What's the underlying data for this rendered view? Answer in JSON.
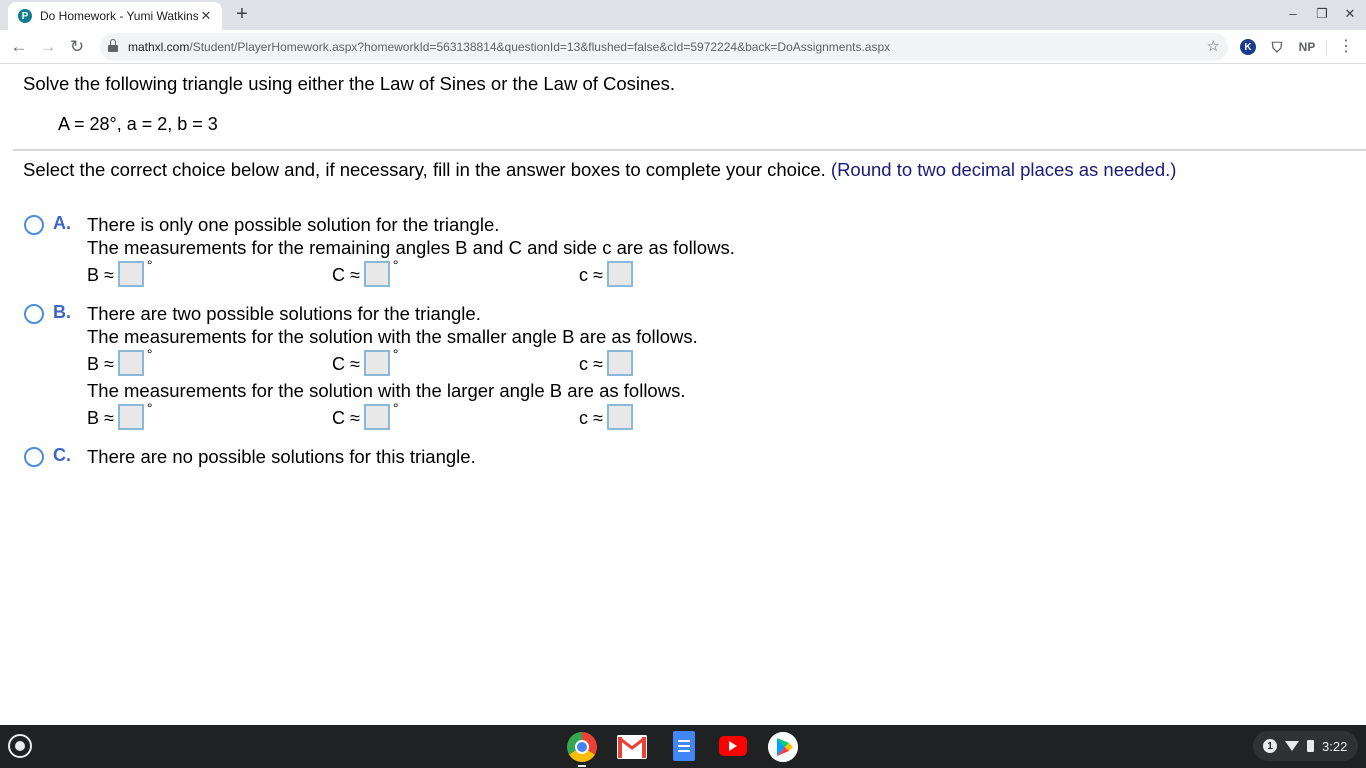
{
  "browser": {
    "tab_title": "Do Homework - Yumi Watkins",
    "favicon_letter": "P",
    "url_host": "mathxl.com",
    "url_path": "/Student/PlayerHomework.aspx?homeworkId=563138814&questionId=13&flushed=false&cId=5972224&back=DoAssignments.aspx",
    "extensions": {
      "k_label": "K",
      "np_label": "NP"
    }
  },
  "question": {
    "instruction": "Solve the following triangle using either the Law of Sines or the Law of Cosines.",
    "given": "A = 28°, a = 2, b = 3",
    "select_instruction": "Select the correct choice below and, if necessary, fill in the answer boxes to complete your choice.",
    "hint": "(Round to two decimal places as needed.)"
  },
  "choices": {
    "a": {
      "letter": "A.",
      "text": "There is only one possible solution for the triangle.",
      "sub": "The measurements for the remaining angles B and C and side c are as follows."
    },
    "b": {
      "letter": "B.",
      "text": "There are two possible solutions for the triangle.",
      "sub_small": "The measurements for the solution with the smaller angle B are as follows.",
      "sub_large": "The measurements for the solution with the larger angle B are as follows."
    },
    "c": {
      "letter": "C.",
      "text": "There are no possible solutions for this triangle."
    }
  },
  "answer_labels": {
    "B": "B ≈",
    "C": "C ≈",
    "c": "c ≈",
    "degree": "°"
  },
  "shelf": {
    "notification_count": "1",
    "time": "3:22"
  }
}
